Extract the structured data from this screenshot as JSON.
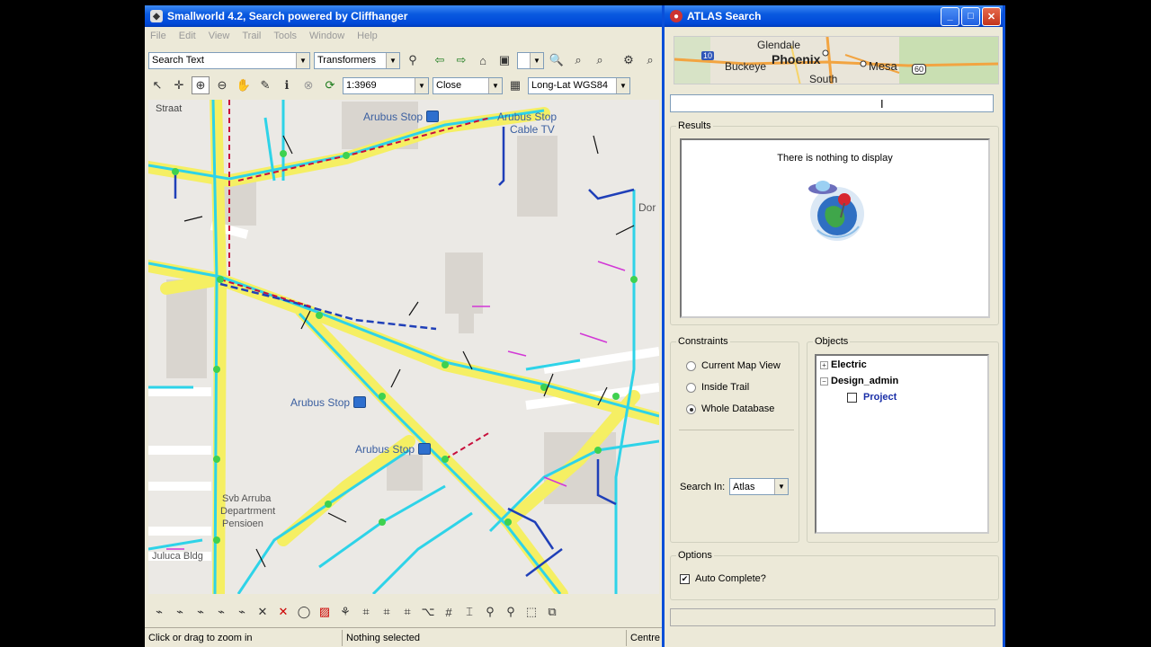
{
  "main_window": {
    "title": "Smallworld 4.2, Search powered by Cliffhanger",
    "menu": [
      "File",
      "Edit",
      "View",
      "Trail",
      "Tools",
      "Window",
      "Help"
    ],
    "search_text_combo": "Search Text",
    "object_combo": "Transformers",
    "scale_combo": "1:3969",
    "close_combo": "Close",
    "coord_combo": "Long-Lat WGS84",
    "status_hint": "Click or drag to zoom in",
    "status_selection": "Nothing selected",
    "status_right": "Centre"
  },
  "map_labels": {
    "stop1": "Arubus Stop",
    "stop2": "Arubus Stop",
    "stop3": "Arubus Stop",
    "stop4": "Arubus Stop",
    "cable": "Cable TV",
    "street_top": "Straat",
    "dept1": "Svb Arruba",
    "dept2": "Departrment",
    "dept3": "Pensioen",
    "bldg": "Juluca Bldg",
    "dor": "Dor"
  },
  "atlas": {
    "title": "ATLAS Search",
    "minimap": {
      "city1": "Glendale",
      "city2": "Phoenix",
      "city3": "Buckeye",
      "city4": "Mesa",
      "city5": "South",
      "hw1": "10",
      "hw2": "60"
    },
    "results_legend": "Results",
    "empty_message": "There is nothing to display",
    "constraints_legend": "Constraints",
    "constraints": [
      {
        "label": "Current Map View",
        "selected": false
      },
      {
        "label": "Inside Trail",
        "selected": false
      },
      {
        "label": "Whole Database",
        "selected": true
      }
    ],
    "search_in_label": "Search In:",
    "search_in_value": "Atlas",
    "objects_legend": "Objects",
    "tree": {
      "electric": "Electric",
      "design": "Design_admin",
      "project": "Project"
    },
    "options_legend": "Options",
    "auto_complete": "Auto Complete?",
    "auto_complete_checked": true
  },
  "colors": {
    "title_blue": "#0a5ae0",
    "road_yellow": "#f5ef63",
    "cyan": "#2ed3e8",
    "map_bg": "#ebe9e5"
  }
}
